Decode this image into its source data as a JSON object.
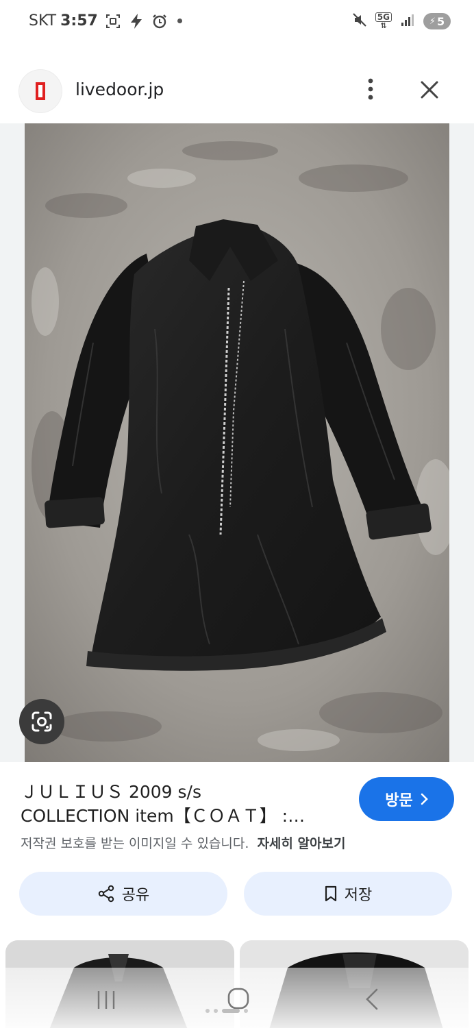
{
  "status_bar": {
    "carrier": "SKT",
    "time": "3:57",
    "network": "5G",
    "battery": "5"
  },
  "browser": {
    "site_name": "livedoor.jp",
    "icons": [
      "site-logo-icon",
      "more-vert-icon",
      "close-icon"
    ]
  },
  "image": {
    "subject": "black zip coat on concrete floor",
    "lens_icon": "google-lens-icon"
  },
  "result": {
    "title_line1": "ＪＵＬＩＵＳ 2009 s/s",
    "title_line2": "COLLECTION item【ＣＯＡＴ】 :…",
    "visit_label": "방문",
    "copyright_text": "저작권 보호를 받는 이미지일 수 있습니다.",
    "learn_more_label": "자세히 알아보기"
  },
  "actions": {
    "share_label": "공유",
    "save_label": "저장"
  },
  "colors": {
    "accent": "#1a73e8",
    "action_bg": "#e8f0fe",
    "image_bg": "#f1f3f4"
  }
}
